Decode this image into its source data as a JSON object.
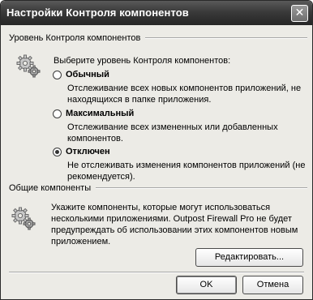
{
  "window": {
    "title": "Настройки Контроля компонентов",
    "close_glyph": "✕"
  },
  "component_control": {
    "group_label": "Уровень Контроля компонентов",
    "prompt": "Выберите уровень Контроля компонентов:",
    "options": [
      {
        "label": "Обычный",
        "checked": false,
        "desc_lines": [
          "Отслеживание всех новых компонентов приложений, не",
          "находящихся в папке приложения."
        ]
      },
      {
        "label": "Максимальный",
        "checked": false,
        "desc_lines": [
          "Отслеживание всех измененных или добавленных",
          "компонентов."
        ]
      },
      {
        "label": "Отключен",
        "checked": true,
        "desc_lines": [
          "Не отслеживать изменения компонентов приложений (не",
          "рекомендуется)."
        ]
      }
    ]
  },
  "shared_components": {
    "group_label": "Общие компоненты",
    "desc_lines": [
      "Укажите компоненты, которые могут использоваться",
      "несколькими приложениями. Outpost Firewall Pro не будет",
      "предупреждать об использовании этих компонентов новым",
      "приложением."
    ],
    "edit_button": "Редактировать..."
  },
  "footer": {
    "ok_button": "OK",
    "cancel_button": "Отмена"
  },
  "icons": {
    "component_control_icon": "gears-icon",
    "shared_components_icon": "gears-icon"
  },
  "colors": {
    "titlebar": "#333333",
    "dialog_bg": "#ecebe6"
  }
}
